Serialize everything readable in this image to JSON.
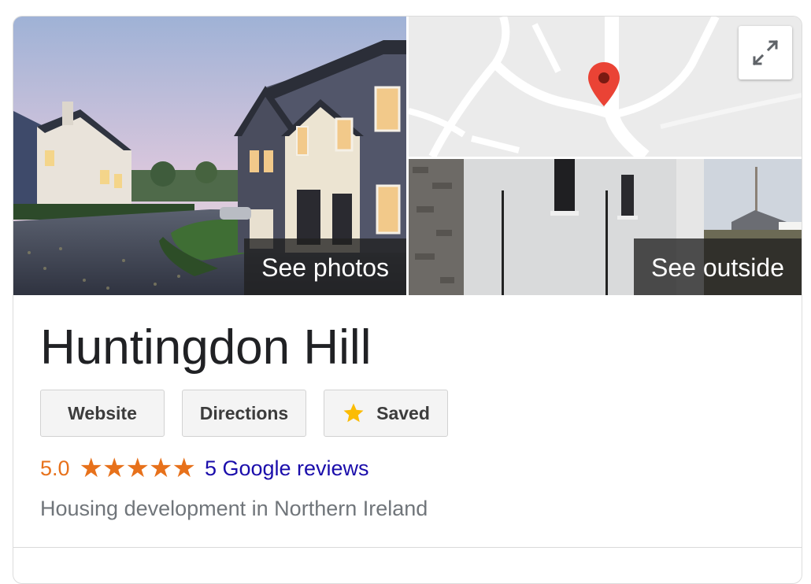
{
  "photos": {
    "see_photos_label": "See photos",
    "see_outside_label": "See outside"
  },
  "map": {
    "pin_color": "#ea4335"
  },
  "place": {
    "title": "Huntingdon Hill",
    "subtitle": "Housing development in Northern Ireland"
  },
  "buttons": {
    "website_label": "Website",
    "directions_label": "Directions",
    "saved_label": "Saved",
    "saved_icon": "star-icon",
    "saved_icon_color": "#fbbc04"
  },
  "rating": {
    "score": "5.0",
    "stars_value": 5,
    "stars_max": 5,
    "stars_glyphs": "★★★★★",
    "reviews_label": "5 Google reviews",
    "accent_color": "#e7711b",
    "link_color": "#1a0dab"
  }
}
